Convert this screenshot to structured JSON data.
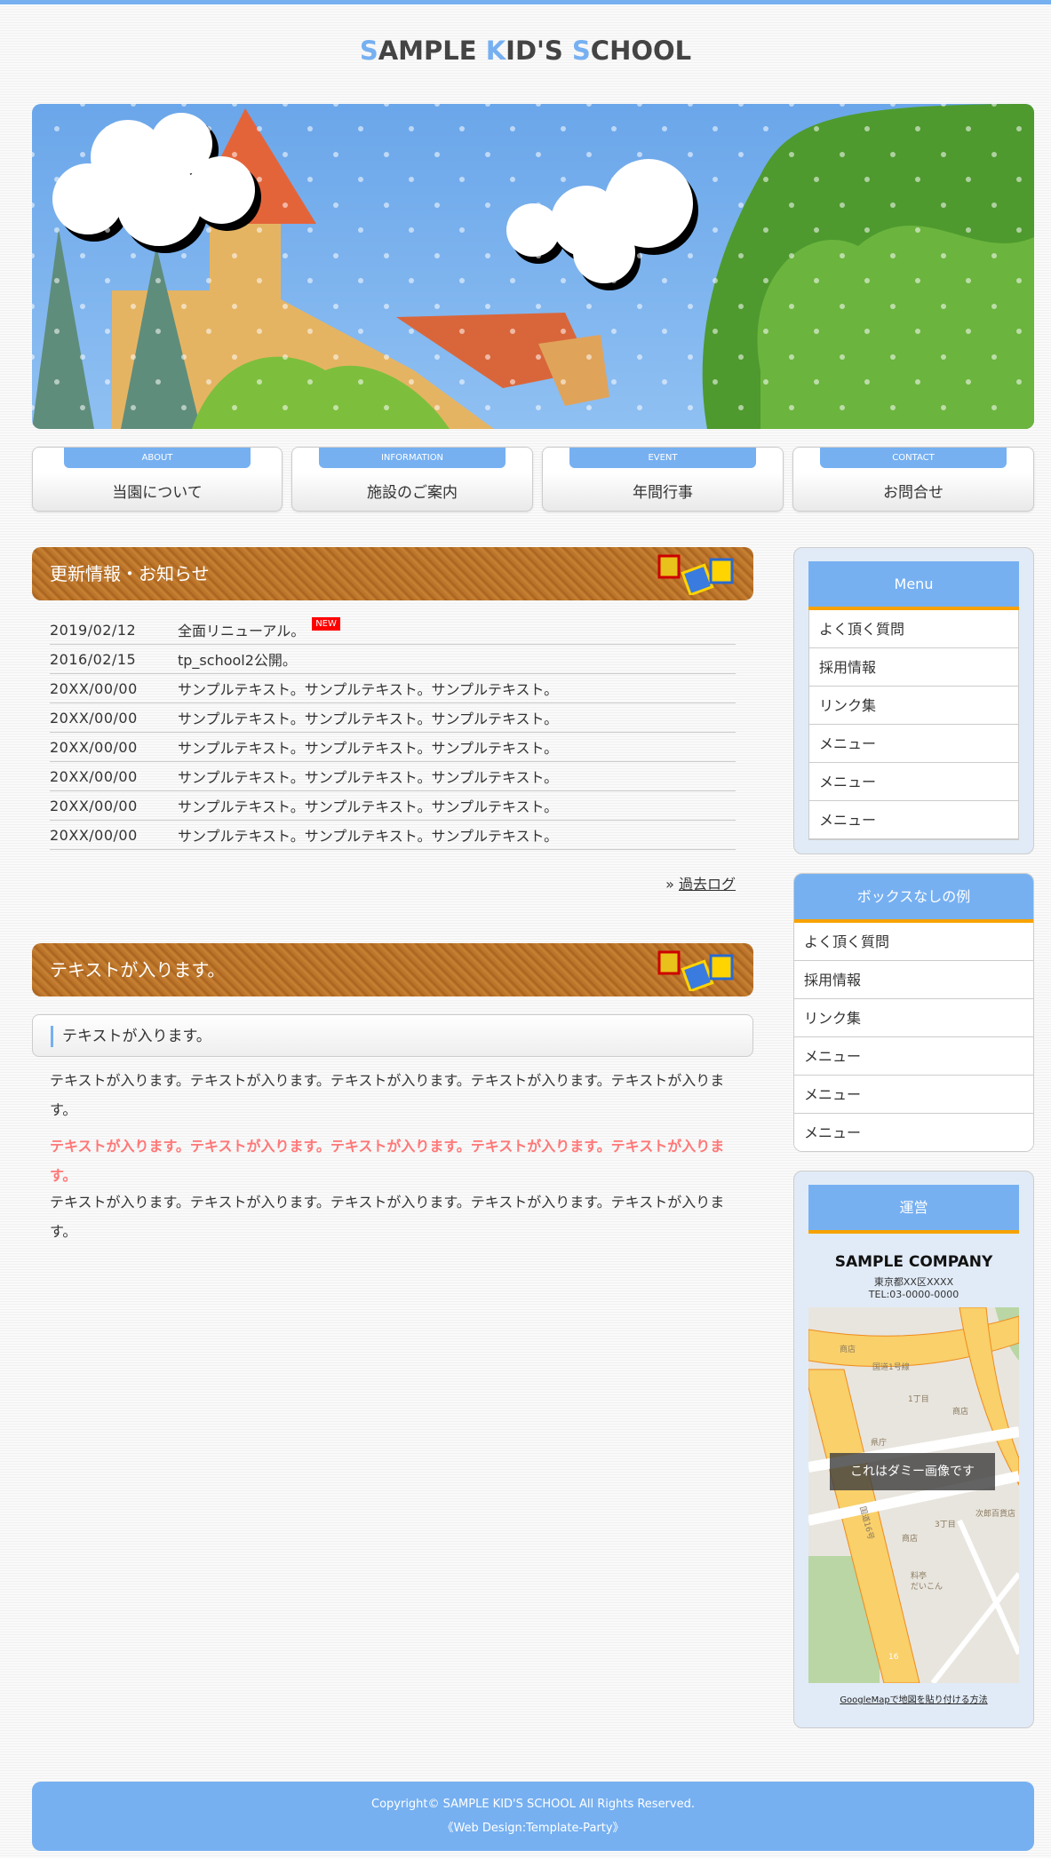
{
  "logo": {
    "s1": "S",
    "t1": "AMPLE ",
    "k": "K",
    "t2": "ID'S ",
    "s2": "S",
    "t3": "CHOOL"
  },
  "nav": [
    {
      "en": "ABOUT",
      "jp": "当園について"
    },
    {
      "en": "INFORMATION",
      "jp": "施設のご案内"
    },
    {
      "en": "EVENT",
      "jp": "年間行事"
    },
    {
      "en": "CONTACT",
      "jp": "お問合せ"
    }
  ],
  "news": {
    "title": "更新情報・お知らせ",
    "new_badge": "NEW",
    "more": "過去ログ",
    "more_prefix": "»",
    "items": [
      {
        "date": "2019/02/12",
        "text": "全面リニューアル。"
      },
      {
        "date": "2016/02/15",
        "text": "tp_school2公開。"
      },
      {
        "date": "20XX/00/00",
        "text": "サンプルテキスト。サンプルテキスト。サンプルテキスト。"
      },
      {
        "date": "20XX/00/00",
        "text": "サンプルテキスト。サンプルテキスト。サンプルテキスト。"
      },
      {
        "date": "20XX/00/00",
        "text": "サンプルテキスト。サンプルテキスト。サンプルテキスト。"
      },
      {
        "date": "20XX/00/00",
        "text": "サンプルテキスト。サンプルテキスト。サンプルテキスト。"
      },
      {
        "date": "20XX/00/00",
        "text": "サンプルテキスト。サンプルテキスト。サンプルテキスト。"
      },
      {
        "date": "20XX/00/00",
        "text": "サンプルテキスト。サンプルテキスト。サンプルテキスト。"
      }
    ]
  },
  "section2": {
    "title": "テキストが入ります。",
    "subheading": "テキストが入ります。",
    "p1": "テキストが入ります。テキストが入ります。テキストが入ります。テキストが入ります。テキストが入ります。",
    "p2": "テキストが入ります。テキストが入ります。テキストが入ります。テキストが入ります。テキストが入ります。",
    "p3": "テキストが入ります。テキストが入ります。テキストが入ります。テキストが入ります。テキストが入ります。"
  },
  "sidebar": {
    "menu": {
      "title": "Menu",
      "items": [
        "よく頂く質問",
        "採用情報",
        "リンク集",
        "メニュー",
        "メニュー",
        "メニュー"
      ]
    },
    "nobox": {
      "title": "ボックスなしの例",
      "items": [
        "よく頂く質問",
        "採用情報",
        "リンク集",
        "メニュー",
        "メニュー",
        "メニュー"
      ]
    },
    "company": {
      "title": "運営",
      "name": "SAMPLE COMPANY",
      "address": "東京都XX区XXXX",
      "tel": "TEL:03-0000-0000",
      "map_overlay": "これはダミー画像です",
      "map_link": "GoogleMapで地図を貼り付ける方法",
      "map_labels": [
        "商店",
        "国道1号線",
        "1丁目",
        "商店",
        "県庁",
        "国道16号",
        "3丁目",
        "商店",
        "次郎百貨店",
        "料亭",
        "だいこん",
        "16"
      ]
    }
  },
  "footer": {
    "copyright": "Copyright© SAMPLE KID'S SCHOOL All Rights Reserved.",
    "credit": "《Web Design:Template-Party》"
  },
  "colors": {
    "accent": "#76b0f1",
    "orange": "#f7a200",
    "red_text": "#ff7777"
  }
}
